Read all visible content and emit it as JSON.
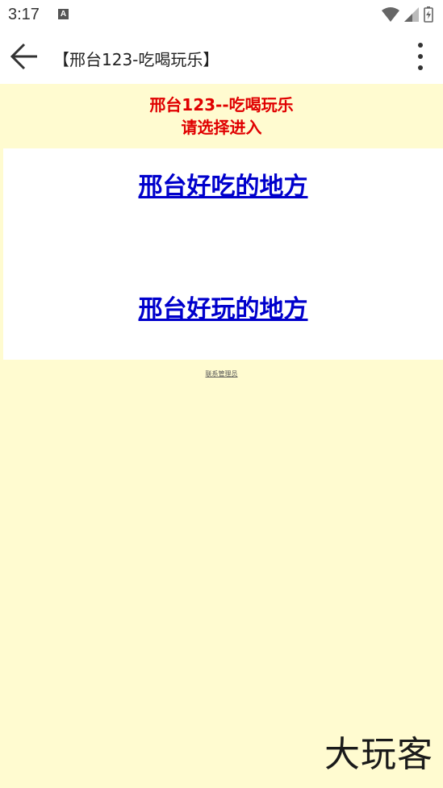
{
  "status_bar": {
    "time": "3:17",
    "notification_icon": "A"
  },
  "toolbar": {
    "title": "【邢台123-吃喝玩乐】"
  },
  "page": {
    "heading_line1": "邢台123--吃喝玩乐",
    "heading_line2": "请选择进入",
    "link_eat": "邢台好吃的地方",
    "link_play": "邢台好玩的地方",
    "admin_link": "联系管理员"
  },
  "watermark": "大玩客",
  "colors": {
    "page_background": "#fffbd0",
    "heading": "#e00000",
    "link": "#0000cc"
  }
}
